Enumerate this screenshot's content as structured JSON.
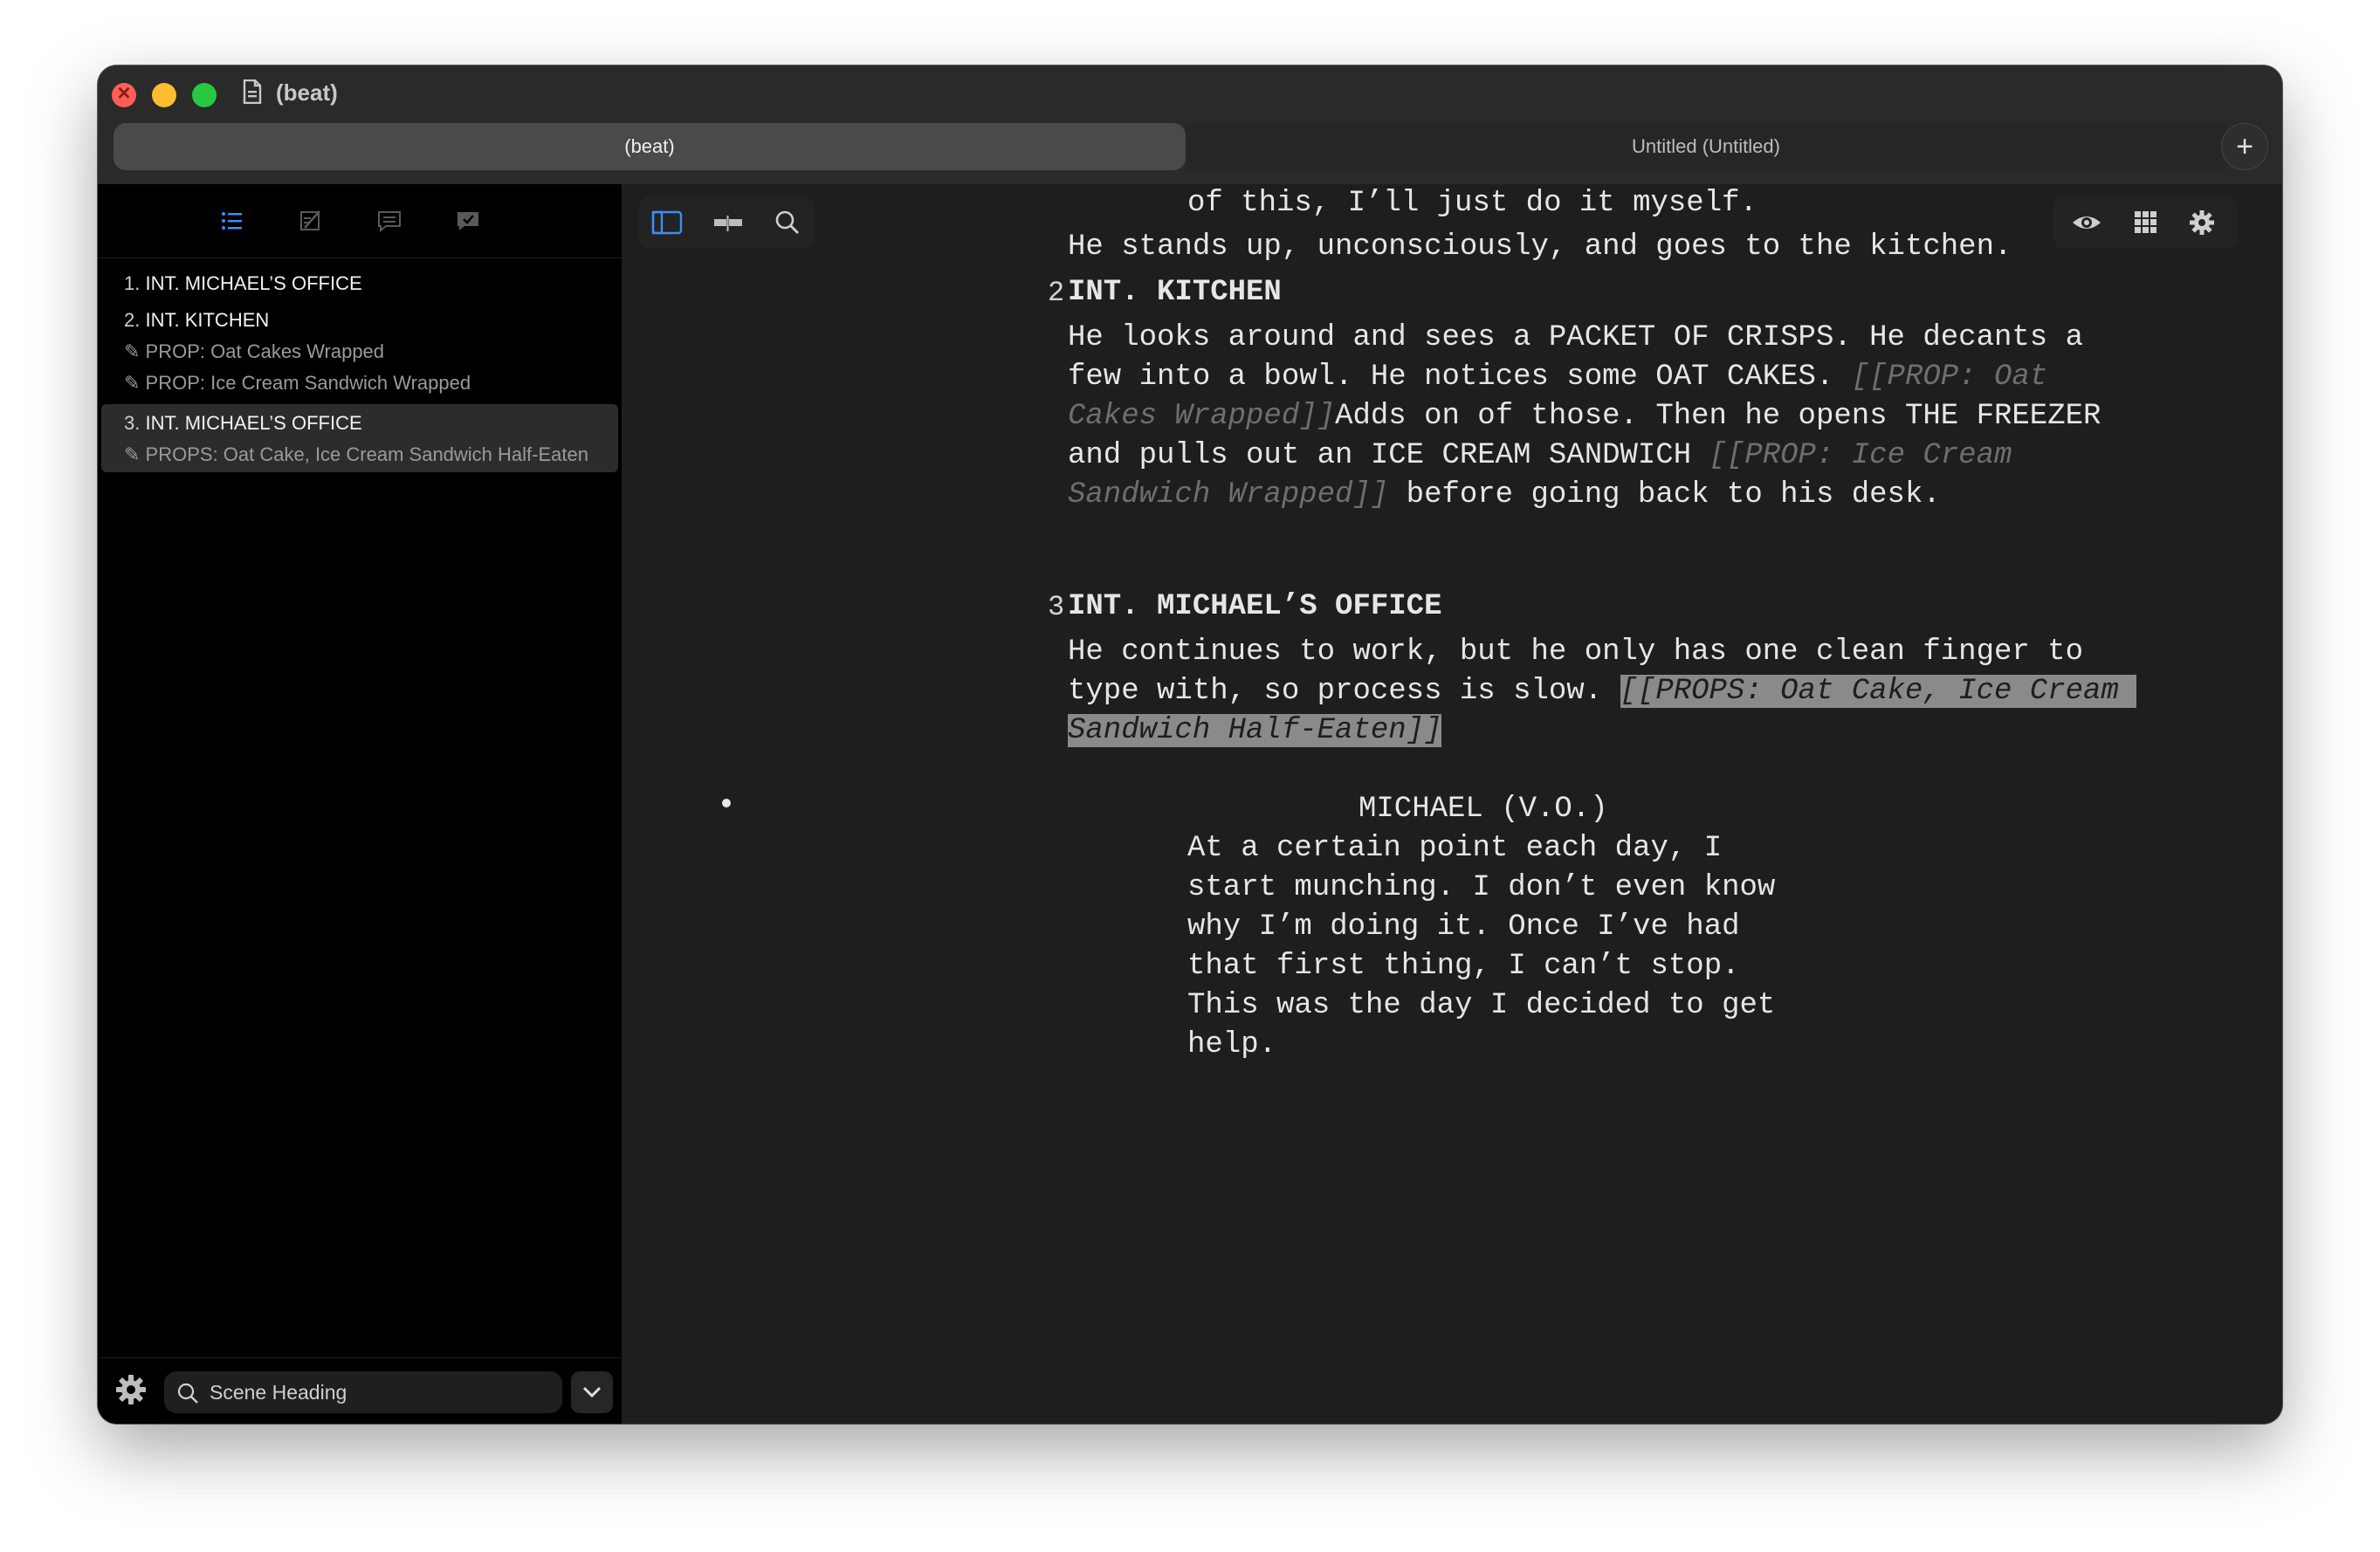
{
  "window": {
    "title": "(beat)"
  },
  "tabs": [
    {
      "label": "(beat)",
      "active": true
    },
    {
      "label": "Untitled (Untitled)",
      "active": false
    }
  ],
  "add_tab_icon": "plus-icon",
  "sidebar": {
    "tab_icons": [
      "outline-icon",
      "notes-icon",
      "comments-icon",
      "reviews-icon"
    ],
    "outline": [
      {
        "number": "1.",
        "heading": "INT. MICHAEL’S OFFICE",
        "notes": [],
        "selected": false
      },
      {
        "number": "2.",
        "heading": "INT. KITCHEN",
        "notes": [
          "✎ PROP: Oat Cakes Wrapped",
          "✎ PROP: Ice Cream Sandwich Wrapped"
        ],
        "selected": false
      },
      {
        "number": "3.",
        "heading": "INT. MICHAEL’S OFFICE",
        "notes": [
          "✎ PROPS: Oat Cake, Ice Cream Sandwich Half-Eaten"
        ],
        "selected": true
      }
    ],
    "footer": {
      "search_label": "Scene Heading",
      "search_icon": "search-icon",
      "settings_icon": "gear-icon",
      "dropdown_icon": "chevron-down-icon"
    }
  },
  "editor": {
    "toolbar_left_icons": [
      "sidebar-toggle-icon",
      "timeline-icon",
      "search-icon"
    ],
    "toolbar_right_icons": [
      "preview-eye-icon",
      "cards-grid-icon",
      "settings-gear-icon"
    ],
    "script": {
      "l1": "of this, I’ll just do it myself.",
      "l2": "He stands up, unconsciously, and goes to the kitchen.",
      "scene2_number": "2",
      "scene2_heading": "INT. KITCHEN",
      "a1": "He looks around and sees a PACKET OF CRISPS. He decants a",
      "a2a": "few into a bowl. He notices some OAT CAKES. ",
      "a2b": "[[PROP: Oat",
      "a3a": "Cakes Wrapped]]",
      "a3b": "Adds on of those. Then he opens THE FREEZER",
      "a4a": "and pulls out an ICE CREAM SANDWICH ",
      "a4b": "[[PROP: Ice Cream",
      "a5a": "Sandwich Wrapped]]",
      "a5b": " before going back to his desk.",
      "scene3_number": "3",
      "scene3_heading": "INT. MICHAEL’S OFFICE",
      "b1": "He continues to work, but he only has one clean finger to",
      "b2a": "type with, so process is slow. ",
      "b2b": "[[PROPS: Oat Cake, Ice Cream ",
      "b3": "Sandwich Half-Eaten]]",
      "character": "MICHAEL (V.O.)",
      "d1": "At a certain point each day, I",
      "d2": "start munching. I don’t even know",
      "d3": "why I’m doing it. Once I’ve had",
      "d4": "that first thing, I can’t stop.",
      "d5": "This was the day I decided to get",
      "d6": "help."
    }
  }
}
